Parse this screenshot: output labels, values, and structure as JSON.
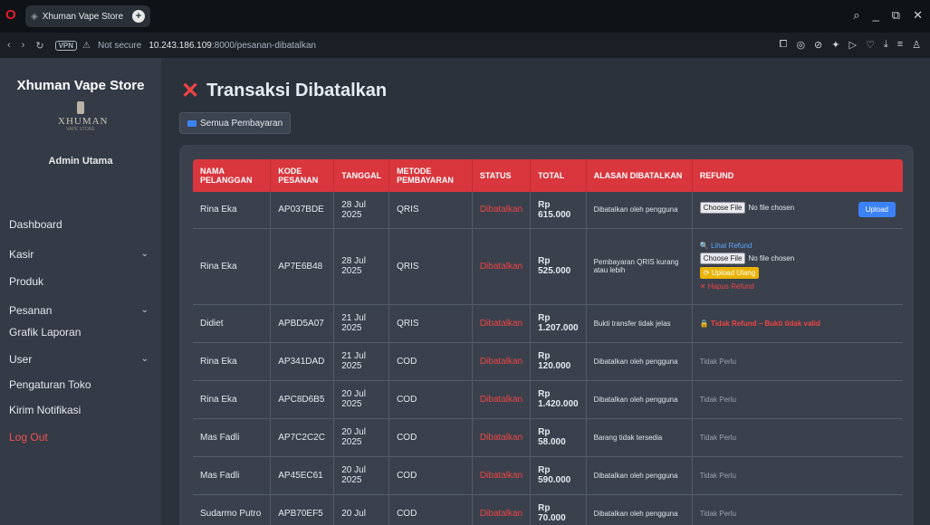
{
  "browser": {
    "tab_title": "Xhuman Vape Store",
    "security": "Not secure",
    "url_host": "10.243.186.109",
    "url_path": ":8000/pesanan-dibatalkan"
  },
  "sidebar": {
    "brand": "Xhuman Vape Store",
    "logo_text": "XHUMAN",
    "logo_sub": "VAPE STORE",
    "admin": "Admin Utama",
    "items": [
      {
        "label": "Dashboard"
      },
      {
        "label": "Kasir"
      },
      {
        "label": "Produk"
      },
      {
        "label": "Pesanan"
      },
      {
        "label": "Grafik Laporan"
      },
      {
        "label": "User"
      },
      {
        "label": "Pengaturan Toko"
      },
      {
        "label": "Kirim Notifikasi"
      },
      {
        "label": "Log Out"
      }
    ]
  },
  "page": {
    "title": "Transaksi Dibatalkan",
    "all_payments": "Semua Pembayaran"
  },
  "table": {
    "headers": [
      "NAMA PELANGGAN",
      "KODE PESANAN",
      "TANGGAL",
      "METODE PEMBAYARAN",
      "STATUS",
      "TOTAL",
      "ALASAN DIBATALKAN",
      "REFUND"
    ],
    "rows": [
      {
        "name": "Rina Eka",
        "code": "AP037BDE",
        "date": "28 Jul 2025",
        "method": "QRIS",
        "status": "Dibatalkan",
        "total": "Rp 615.000",
        "reason": "Dibatalkan oleh pengguna"
      },
      {
        "name": "Rina Eka",
        "code": "AP7E6B48",
        "date": "28 Jul 2025",
        "method": "QRIS",
        "status": "Dibatalkan",
        "total": "Rp 525.000",
        "reason": "Pembayaran QRIS kurang atau lebih"
      },
      {
        "name": "Didiet",
        "code": "APBD5A07",
        "date": "21 Jul 2025",
        "method": "QRIS",
        "status": "Dibatalkan",
        "total": "Rp 1.207.000",
        "reason": "Bukti transfer tidak jelas"
      },
      {
        "name": "Rina Eka",
        "code": "AP341DAD",
        "date": "21 Jul 2025",
        "method": "COD",
        "status": "Dibatalkan",
        "total": "Rp 120.000",
        "reason": "Dibatalkan oleh pengguna"
      },
      {
        "name": "Rina Eka",
        "code": "APC8D6B5",
        "date": "20 Jul 2025",
        "method": "COD",
        "status": "Dibatalkan",
        "total": "Rp 1.420.000",
        "reason": "Dibatalkan oleh pengguna"
      },
      {
        "name": "Mas Fadli",
        "code": "AP7C2C2C",
        "date": "20 Jul 2025",
        "method": "COD",
        "status": "Dibatalkan",
        "total": "Rp 58.000",
        "reason": "Barang tidak tersedia"
      },
      {
        "name": "Mas Fadli",
        "code": "AP45EC61",
        "date": "20 Jul 2025",
        "method": "COD",
        "status": "Dibatalkan",
        "total": "Rp 590.000",
        "reason": "Dibatalkan oleh pengguna"
      },
      {
        "name": "Sudarmo Putro",
        "code": "APB70EF5",
        "date": "20 Jul",
        "method": "COD",
        "status": "Dibatalkan",
        "total": "Rp 70.000",
        "reason": "Dibatalkan oleh pengguna"
      }
    ],
    "refund": {
      "choose_file": "Choose File",
      "no_file": "No file chosen",
      "upload": "Upload",
      "lihat": "Lihat Refund",
      "upload_ulang": "Upload Ulang",
      "hapus": "Hapus Refund",
      "tidak_refund": "Tidak Refund – Bukti tidak valid",
      "tidak_perlu": "Tidak Perlu"
    }
  }
}
